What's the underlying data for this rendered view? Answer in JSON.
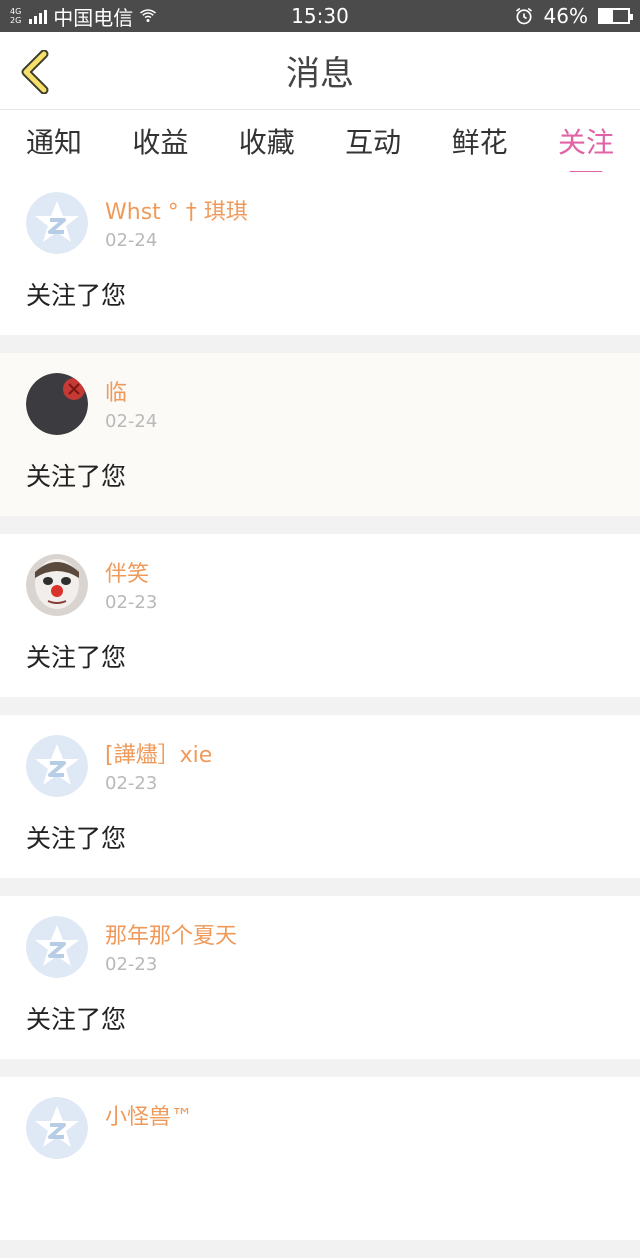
{
  "status_bar": {
    "network_top": "4G",
    "network_bottom": "2G",
    "carrier": "中国电信",
    "time": "15:30",
    "battery": "46%",
    "battery_level": 0.46
  },
  "header": {
    "title": "消息"
  },
  "tabs": [
    {
      "label": "通知",
      "active": false
    },
    {
      "label": "收益",
      "active": false
    },
    {
      "label": "收藏",
      "active": false
    },
    {
      "label": "互动",
      "active": false
    },
    {
      "label": "鲜花",
      "active": false
    },
    {
      "label": "关注",
      "active": true
    }
  ],
  "items": [
    {
      "name": "Whst ° † 琪琪",
      "date": "02-24",
      "message": "关注了您",
      "avatar": "default-star-avatar"
    },
    {
      "name": "临",
      "date": "02-24",
      "message": "关注了您",
      "avatar": "dark-seal-avatar"
    },
    {
      "name": "伴笑",
      "date": "02-23",
      "message": "关注了您",
      "avatar": "clown-face-avatar"
    },
    {
      "name": "[譁燼］xie",
      "date": "02-23",
      "message": "关注了您",
      "avatar": "default-star-avatar"
    },
    {
      "name": "那年那个夏天",
      "date": "02-23",
      "message": "关注了您",
      "avatar": "default-star-avatar"
    },
    {
      "name": "小怪兽™",
      "date": "",
      "message": "",
      "avatar": "default-star-avatar"
    }
  ],
  "colors": {
    "accent": "#e063a5",
    "username": "#ef9a5a",
    "back_arrow": "#f6df6b",
    "status_bar": "#4b4b4b"
  }
}
